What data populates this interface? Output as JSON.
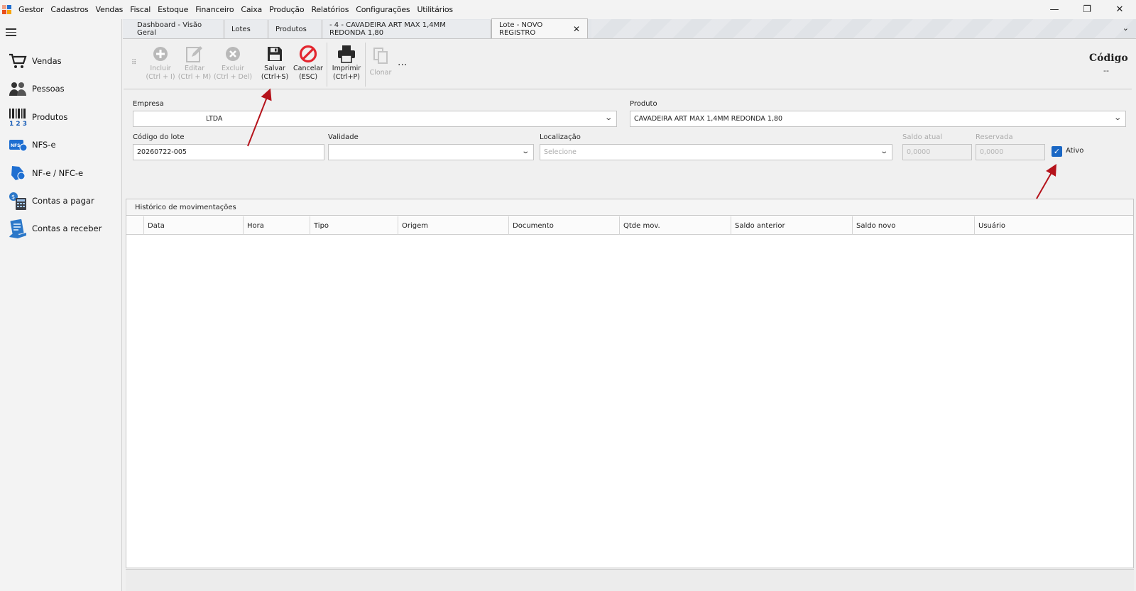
{
  "menu": [
    "Gestor",
    "Cadastros",
    "Vendas",
    "Fiscal",
    "Estoque",
    "Financeiro",
    "Caixa",
    "Produção",
    "Relatórios",
    "Configurações",
    "Utilitários"
  ],
  "window_controls": {
    "minimize": "—",
    "restore": "❐",
    "close": "✕"
  },
  "sidebar": {
    "items": [
      {
        "label": "Vendas",
        "icon": "cart-icon"
      },
      {
        "label": "Pessoas",
        "icon": "people-icon"
      },
      {
        "label": "Produtos",
        "icon": "barcode-icon"
      },
      {
        "label": "NFS-e",
        "icon": "nfse-icon"
      },
      {
        "label": "NF-e / NFC-e",
        "icon": "nfe-icon"
      },
      {
        "label": "Contas a pagar",
        "icon": "bills-payable-icon"
      },
      {
        "label": "Contas a receber",
        "icon": "bills-receivable-icon"
      }
    ]
  },
  "tabs": [
    {
      "label": "Dashboard - Visão Geral"
    },
    {
      "label": "Lotes"
    },
    {
      "label": "Produtos"
    },
    {
      "label": " - 4 - CAVADEIRA ART MAX 1,4MM REDONDA 1,80"
    },
    {
      "label": "Lote - NOVO REGISTRO",
      "active": true
    }
  ],
  "tab_close": "✕",
  "tabs_overflow": "⌄",
  "toolbar": {
    "incluir": {
      "label1": "Incluir",
      "label2": "(Ctrl + I)"
    },
    "editar": {
      "label1": "Editar",
      "label2": "(Ctrl + M)"
    },
    "excluir": {
      "label1": "Excluir",
      "label2": "(Ctrl + Del)"
    },
    "salvar": {
      "label1": "Salvar",
      "label2": "(Ctrl+S)"
    },
    "cancelar": {
      "label1": "Cancelar",
      "label2": "(ESC)"
    },
    "imprimir": {
      "label1": "Imprimir",
      "label2": "(Ctrl+P)"
    },
    "clonar": {
      "label1": "Clonar"
    },
    "more": "...",
    "grip": "⠿"
  },
  "header": {
    "codigo_label": "Código",
    "codigo_value": "--"
  },
  "form": {
    "empresa": {
      "label": "Empresa",
      "value": "LTDA"
    },
    "produto": {
      "label": "Produto",
      "value": "CAVADEIRA ART MAX 1,4MM REDONDA 1,80"
    },
    "codigo_lote": {
      "label": "Código do lote",
      "value": "20260722-005"
    },
    "validade": {
      "label": "Validade",
      "value": ""
    },
    "localizacao": {
      "label": "Localização",
      "placeholder": "Selecione"
    },
    "saldo_atual": {
      "label": "Saldo atual",
      "value": "0,0000"
    },
    "reservada": {
      "label": "Reservada",
      "value": "0,0000"
    },
    "ativo": {
      "label": "Ativo",
      "checked": true,
      "mark": "✓"
    },
    "chevron": "⌄"
  },
  "history": {
    "title": "Histórico de movimentações",
    "columns": [
      "Data",
      "Hora",
      "Tipo",
      "Origem",
      "Documento",
      "Qtde mov.",
      "Saldo anterior",
      "Saldo novo",
      "Usuário"
    ],
    "rows": []
  },
  "colors": {
    "accent": "#1a67c4",
    "annotation": "#b5131b",
    "cancel": "#e3262f"
  }
}
